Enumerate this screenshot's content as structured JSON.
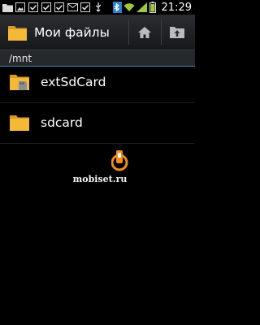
{
  "status_bar": {
    "time": "21:29",
    "notification_icons": [
      "folder-notification-icon",
      "image-notification-icon",
      "checkbox-notification-icon",
      "checkbox-notification-icon",
      "checkbox-notification-icon",
      "mail-notification-icon",
      "checkbox-notification-icon",
      "usb-icon"
    ],
    "status_icons": [
      "bluetooth-icon",
      "wifi-icon",
      "signal-icon",
      "battery-icon"
    ]
  },
  "action_bar": {
    "title": "Мои файлы",
    "home_icon": "home-icon",
    "up_icon": "folder-up-icon"
  },
  "path": "/mnt",
  "files": [
    {
      "name": "extSdCard",
      "icon": "sdcard-folder-icon"
    },
    {
      "name": "sdcard",
      "icon": "folder-icon"
    }
  ],
  "watermark": {
    "text": "mobiset.ru",
    "logo": "mobiset-logo"
  },
  "colors": {
    "folder": "#f5b93a",
    "accent_line": "#3b7fae",
    "background": "#000000",
    "logo": "#f28c1c"
  }
}
